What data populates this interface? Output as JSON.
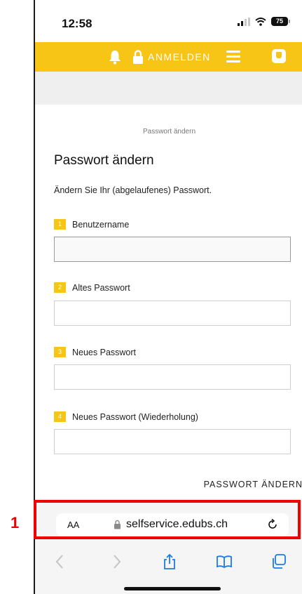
{
  "status_bar": {
    "time": "12:58",
    "battery": "75"
  },
  "topbar": {
    "login_label": "ANMELDEN"
  },
  "breadcrumb": "Passwort ändern",
  "page_title": "Passwort ändern",
  "description": "Ändern Sie Ihr (abgelaufenes) Passwort.",
  "fields": [
    {
      "number": "1",
      "label": "Benutzername",
      "value": ""
    },
    {
      "number": "2",
      "label": "Altes Passwort",
      "value": ""
    },
    {
      "number": "3",
      "label": "Neues Passwort",
      "value": ""
    },
    {
      "number": "4",
      "label": "Neues Passwort (Wiederholung)",
      "value": ""
    }
  ],
  "submit_label": "PASSWORT ÄNDERN",
  "browser": {
    "aa_label": "AA",
    "url": "selfservice.edubs.ch"
  },
  "annotation": {
    "number": "1",
    "color": "#ee0000"
  },
  "colors": {
    "accent": "#f7c516"
  }
}
